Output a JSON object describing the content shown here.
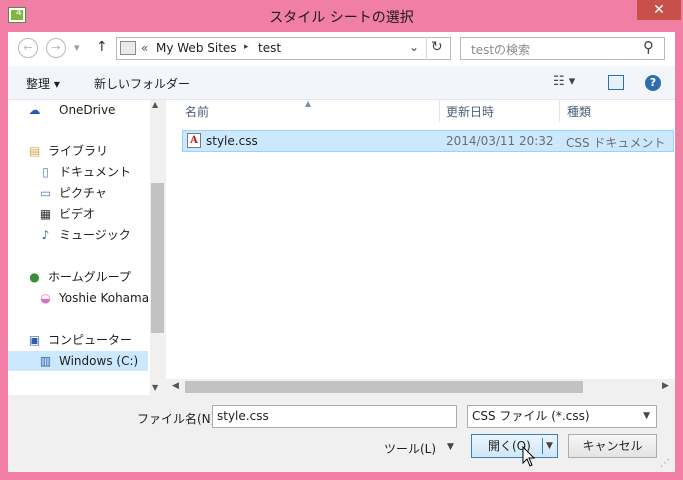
{
  "window": {
    "title": "スタイル シートの選択",
    "close": "✕"
  },
  "nav": {
    "back_icon": "←",
    "forward_icon": "→",
    "recent_icon": "▾",
    "up_icon": "↑"
  },
  "address": {
    "overflow": "«",
    "crumbs": [
      "My Web Sites",
      "test"
    ],
    "separator": "▸",
    "dropdown": "⌄",
    "refresh": "↻"
  },
  "search": {
    "placeholder": "testの検索",
    "icon": "⚲"
  },
  "toolbar": {
    "organize_label": "整理 ▾",
    "new_folder_label": "新しいフォルダー",
    "view_icon": "☷ ▾",
    "preview_icon": "▯",
    "help_icon": "?"
  },
  "sidebar": {
    "items": [
      {
        "label": "OneDrive",
        "icon": "☁",
        "color": "#1e5fb4"
      },
      {
        "label": "ライブラリ",
        "icon": "▤",
        "color": "#d9a540"
      },
      {
        "label": "ドキュメント",
        "icon": "▯",
        "color": "#5c84b8"
      },
      {
        "label": "ピクチャ",
        "icon": "▭",
        "color": "#4d7eb3"
      },
      {
        "label": "ビデオ",
        "icon": "▦",
        "color": "#333333"
      },
      {
        "label": "ミュージック",
        "icon": "♪",
        "color": "#2f5fa8"
      },
      {
        "label": "ホームグループ",
        "icon": "●",
        "color": "#3a8d3a"
      },
      {
        "label": "Yoshie Kohama",
        "icon": "◒",
        "color": "#d770c5"
      },
      {
        "label": "コンピューター",
        "icon": "▣",
        "color": "#2f5fa8"
      },
      {
        "label": "Windows (C:)",
        "icon": "▥",
        "color": "#2f5fa8"
      }
    ]
  },
  "columns": {
    "name": "名前",
    "modified": "更新日時",
    "type": "種類"
  },
  "files": [
    {
      "name": "style.css",
      "modified": "2014/03/11 20:32",
      "type": "CSS ドキュメント",
      "icon": "A"
    }
  ],
  "footer": {
    "filename_label": "ファイル名(N):",
    "filename_value": "style.css",
    "filter_value": "CSS ファイル (*.css)",
    "tools_label": "ツール(L)",
    "open_label": "開く(O)",
    "cancel_label": "キャンセル"
  }
}
